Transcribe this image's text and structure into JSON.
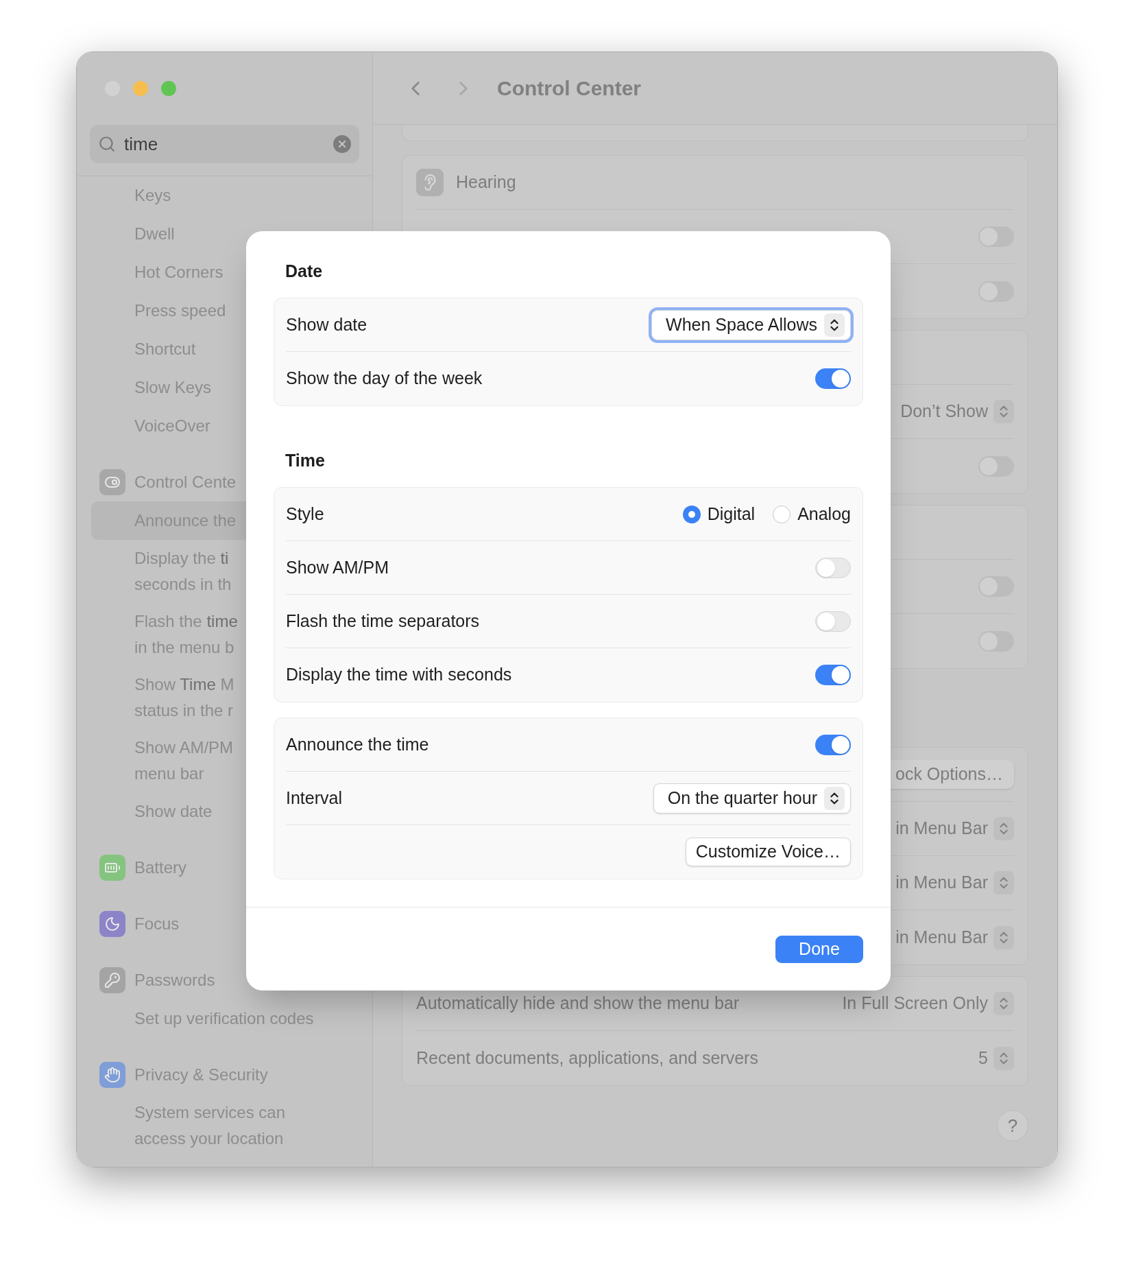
{
  "window": {
    "title": "Control Center",
    "buttons": [
      {
        "color": "#d2d2d2"
      },
      {
        "color": "#f5be4f"
      },
      {
        "color": "#61c554"
      }
    ]
  },
  "sidebar": {
    "search": {
      "value": "time"
    },
    "items": [
      {
        "kind": "result",
        "lines": [
          "Keys"
        ],
        "selected": false
      },
      {
        "kind": "result",
        "lines": [
          "Dwell"
        ],
        "selected": false
      },
      {
        "kind": "result",
        "lines": [
          "Hot Corners"
        ],
        "selected": false
      },
      {
        "kind": "result",
        "lines": [
          "Press speed"
        ],
        "selected": false
      },
      {
        "kind": "result",
        "lines": [
          "Shortcut"
        ],
        "selected": false
      },
      {
        "kind": "result",
        "lines": [
          "Slow Keys"
        ],
        "selected": false
      },
      {
        "kind": "result",
        "lines": [
          "VoiceOver"
        ],
        "selected": false
      },
      {
        "kind": "category",
        "lines": [
          "Control Cente"
        ],
        "color": "#a8a8a8",
        "selected": false
      },
      {
        "kind": "result",
        "lines": [
          "Announce the"
        ],
        "selected": true
      },
      {
        "kind": "result",
        "lines": [
          "Display the **ti**",
          "seconds in th"
        ],
        "selected": false
      },
      {
        "kind": "result",
        "lines": [
          "Flash the **time**",
          "in the menu b"
        ],
        "selected": false
      },
      {
        "kind": "result",
        "lines": [
          "Show **Time** M",
          "status in the r"
        ],
        "selected": false
      },
      {
        "kind": "result",
        "lines": [
          "Show AM/PM",
          "menu bar"
        ],
        "selected": false
      },
      {
        "kind": "result",
        "lines": [
          "Show date"
        ],
        "selected": false
      },
      {
        "kind": "category",
        "lines": [
          "Battery"
        ],
        "color": "#84c47f",
        "selected": false
      },
      {
        "kind": "category",
        "lines": [
          "Focus"
        ],
        "color": "#8c84c8",
        "selected": false
      },
      {
        "kind": "category",
        "lines": [
          "Passwords"
        ],
        "color": "#a4a4a4",
        "selected": false
      },
      {
        "kind": "result",
        "lines": [
          "Set up verification codes"
        ],
        "selected": false
      },
      {
        "kind": "category",
        "lines": [
          "Privacy & Security"
        ],
        "color": "#7f9ed8",
        "selected": false
      },
      {
        "kind": "result",
        "lines": [
          "System services can",
          "access your location"
        ],
        "selected": false
      }
    ]
  },
  "content": {
    "sections": [
      {
        "cards": [
          {
            "rows": [
              {
                "kind": "header",
                "label": "Hearing"
              },
              {
                "kind": "toggle",
                "on": false
              },
              {
                "kind": "toggle",
                "on": false
              }
            ]
          },
          {
            "rows": [
              {
                "kind": "blank"
              },
              {
                "kind": "popup",
                "value": "Don’t Show"
              },
              {
                "kind": "toggle",
                "on": false
              }
            ]
          },
          {
            "rows": [
              {
                "kind": "blank"
              },
              {
                "kind": "toggle",
                "on": false
              },
              {
                "kind": "toggle",
                "on": false
              }
            ]
          }
        ]
      },
      {
        "cards": [
          {
            "rows": [
              {
                "kind": "button",
                "label": "ock Options…"
              },
              {
                "kind": "popup",
                "value": "in Menu Bar"
              },
              {
                "kind": "popup",
                "value": "in Menu Bar"
              },
              {
                "kind": "popup",
                "value": "in Menu Bar"
              }
            ]
          },
          {
            "rows": [
              {
                "kind": "popup",
                "label": "Automatically hide and show the menu bar",
                "value": "In Full Screen Only"
              },
              {
                "kind": "popup",
                "label": "Recent documents, applications, and servers",
                "value": "5"
              }
            ]
          }
        ]
      }
    ],
    "help": {
      "label": "?"
    }
  },
  "sheet": {
    "sections": [
      {
        "title": "Date",
        "groups": [
          {
            "rows": [
              {
                "kind": "popup",
                "label": "Show date",
                "value": "When Space Allows",
                "focused": true
              },
              {
                "kind": "toggle",
                "label": "Show the day of the week",
                "on": true
              }
            ]
          }
        ]
      },
      {
        "title": "Time",
        "groups": [
          {
            "rows": [
              {
                "kind": "radio",
                "label": "Style",
                "options": [
                  {
                    "label": "Digital",
                    "selected": true
                  },
                  {
                    "label": "Analog",
                    "selected": false
                  }
                ]
              },
              {
                "kind": "toggle",
                "label": "Show AM/PM",
                "on": false
              },
              {
                "kind": "toggle",
                "label": "Flash the time separators",
                "on": false
              },
              {
                "kind": "toggle",
                "label": "Display the time with seconds",
                "on": true
              }
            ]
          },
          {
            "rows": [
              {
                "kind": "toggle",
                "label": "Announce the time",
                "on": true
              },
              {
                "kind": "popup",
                "label": "Interval",
                "value": "On the quarter hour",
                "focused": false
              },
              {
                "kind": "button",
                "label": "Customize Voice…"
              }
            ]
          }
        ]
      }
    ],
    "done": {
      "label": "Done"
    }
  }
}
